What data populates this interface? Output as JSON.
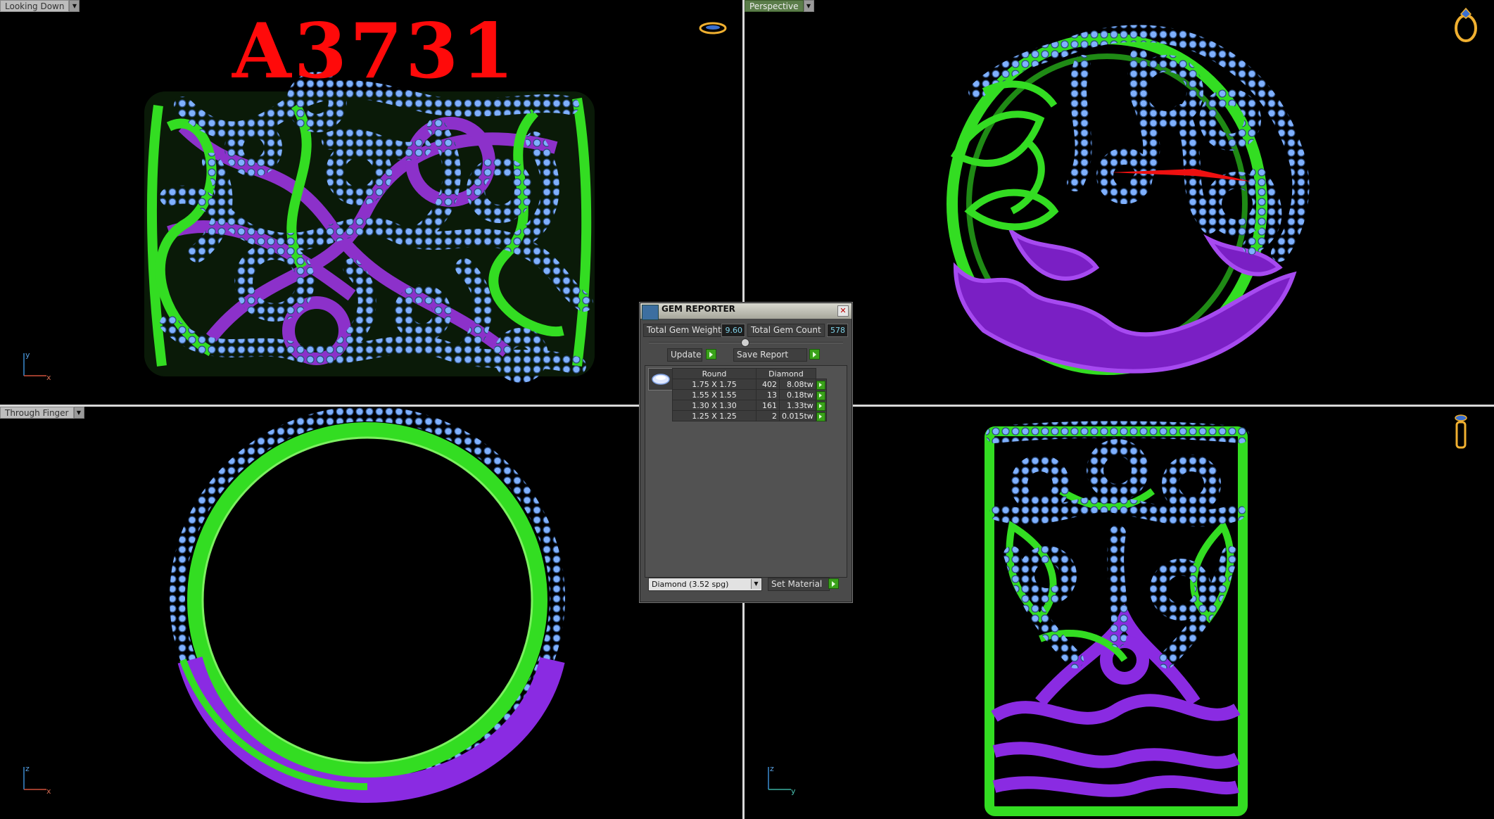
{
  "viewports": {
    "top_left": {
      "label": "Looking Down",
      "axes": {
        "v": "y",
        "h": "x"
      },
      "nav_icon": "ring-top-icon"
    },
    "top_right": {
      "label": "Perspective",
      "nav_icon": "ring-perspective-icon"
    },
    "bottom_left": {
      "label": "Through Finger",
      "axes": {
        "v": "z",
        "h": "x"
      }
    },
    "bottom_right": {
      "axes": {
        "v": "z",
        "h": "y"
      },
      "nav_icon": "ring-side-icon"
    }
  },
  "model_title": "A3731",
  "gem_reporter": {
    "title": "GEM REPORTER",
    "total_weight_label": "Total Gem Weight",
    "total_weight_value": "9.60",
    "total_count_label": "Total Gem Count",
    "total_count_value": "578",
    "update_label": "Update",
    "save_report_label": "Save Report",
    "table": {
      "headers": {
        "shape": "Round",
        "material": "Diamond"
      },
      "rows": [
        {
          "size": "1.75 X 1.75",
          "count": "402",
          "weight": "8.08tw"
        },
        {
          "size": "1.55 X 1.55",
          "count": "13",
          "weight": "0.18tw"
        },
        {
          "size": "1.30 X 1.30",
          "count": "161",
          "weight": "1.33tw"
        },
        {
          "size": "1.25 X 1.25",
          "count": "2",
          "weight": "0.015tw"
        }
      ]
    },
    "material_select": "Diamond    (3.52 spg)",
    "set_material_label": "Set Material"
  },
  "colors": {
    "metal_green": "#33dd22",
    "metal_purple": "#8a2be2",
    "gems": "#7fb0ff",
    "title_red": "#ff0a0a"
  }
}
